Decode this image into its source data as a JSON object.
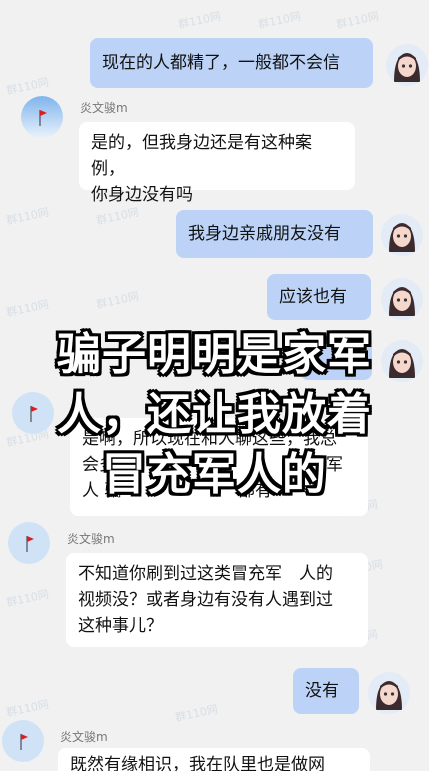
{
  "watermark": "群110网",
  "messages": [
    {
      "side": "out",
      "text": "现在的人都精了，一般都不会信"
    },
    {
      "side": "in",
      "sender": "炎文骏m",
      "lines": [
        "是的，但我身边还是有这种案例，",
        "你身边没有吗"
      ]
    },
    {
      "side": "out",
      "text": "我身边亲戚朋友没有"
    },
    {
      "side": "out",
      "text": "应该也有"
    },
    {
      "side": "in",
      "sender": "炎文骏m",
      "lines": [
        "是啊，所以现在和人聊这些，我总",
        "会多",
        "军",
        "人 骗",
        "部有"
      ]
    },
    {
      "side": "in",
      "sender": "炎文骏m",
      "lines": [
        "不知道你刷到过这类冒充军　人的",
        "视频没？或者身边有没有人遇到过",
        "这种事儿？"
      ]
    },
    {
      "side": "out",
      "text": "没有"
    },
    {
      "side": "in",
      "sender": "炎文骏m",
      "lines": [
        "既然有缘相识，我在队里也是做网"
      ]
    }
  ],
  "overlay": {
    "line1": "骗子明明是家军",
    "line2": "人，还让我放着",
    "line3": "冒充军人的"
  },
  "colors": {
    "out_bubble": "#bcd3f7",
    "in_bubble": "#ffffff",
    "background": "#f1f1f1"
  }
}
